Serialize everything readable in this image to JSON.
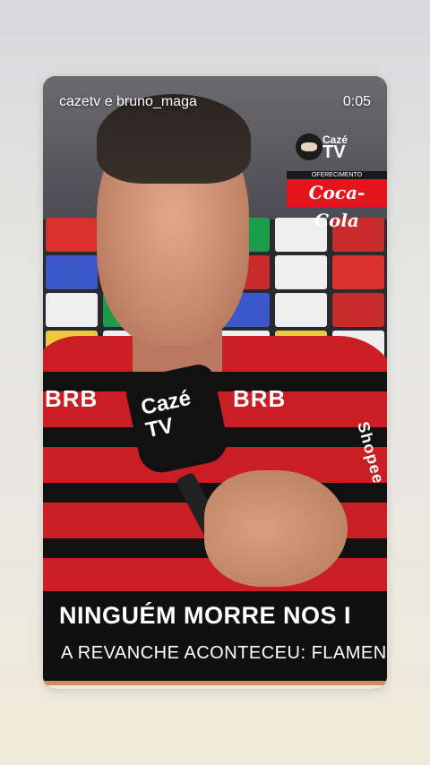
{
  "story": {
    "author": "cazetv e bruno_maga",
    "time": "0:05"
  },
  "logo": {
    "brand": "Cazé",
    "brand_tv": "TV"
  },
  "sponsor": {
    "label": "OFERECIMENTO",
    "name": "Coca-Cola"
  },
  "jersey": {
    "sponsor_left": "BRB",
    "sponsor_right": "BRB",
    "sleeve": "Shopee"
  },
  "microphone": {
    "line1": "Cazé",
    "line2": "TV"
  },
  "caption": {
    "title": "NINGUÉM MORRE NOS I",
    "subtitle": "A REVANCHE ACONTECEU: FLAMEN"
  },
  "colors": {
    "accent_stripe": "#d38a63",
    "coke_red": "#e4141c",
    "flamengo_red": "#c81e24"
  }
}
